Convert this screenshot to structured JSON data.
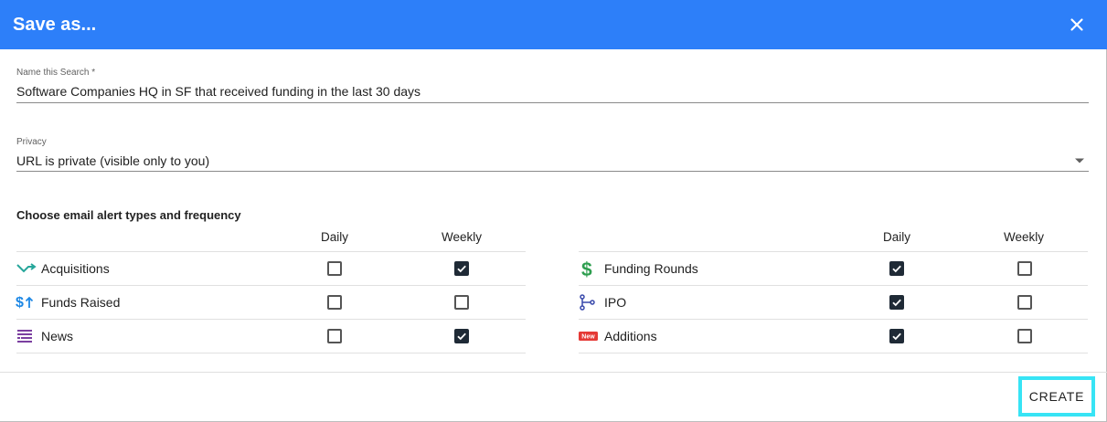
{
  "dialog": {
    "title": "Save as...",
    "close_icon": "close-icon"
  },
  "name_field": {
    "label": "Name this Search *",
    "value": "Software Companies HQ in SF that received funding in the last 30 days"
  },
  "privacy_field": {
    "label": "Privacy",
    "value": "URL is private (visible only to you)"
  },
  "alerts": {
    "title": "Choose email alert types and frequency",
    "col_daily": "Daily",
    "col_weekly": "Weekly",
    "left": [
      {
        "label": "Acquisitions",
        "icon": "acquisitions-arrow-icon",
        "daily": false,
        "weekly": true
      },
      {
        "label": "Funds Raised",
        "icon": "funds-raised-dollar-icon",
        "daily": false,
        "weekly": false
      },
      {
        "label": "News",
        "icon": "news-icon",
        "daily": false,
        "weekly": true
      }
    ],
    "right": [
      {
        "label": "Funding Rounds",
        "icon": "dollar-icon",
        "daily": true,
        "weekly": false
      },
      {
        "label": "IPO",
        "icon": "ipo-icon",
        "daily": true,
        "weekly": false
      },
      {
        "label": "Additions",
        "icon": "new-badge-icon",
        "badge_text": "New",
        "daily": true,
        "weekly": false
      }
    ]
  },
  "footer": {
    "create_label": "CREATE"
  },
  "colors": {
    "header": "#2d7ff9",
    "checkbox_checked": "#1f2a36",
    "create_highlight": "#37e4f5",
    "acquisitions_icon": "#26a69a",
    "funds_icon": "#1e88e5",
    "news_icon": "#7b3fa0",
    "dollar_icon": "#2e9e4f",
    "ipo_icon": "#3949ab",
    "new_badge": "#e53935"
  }
}
